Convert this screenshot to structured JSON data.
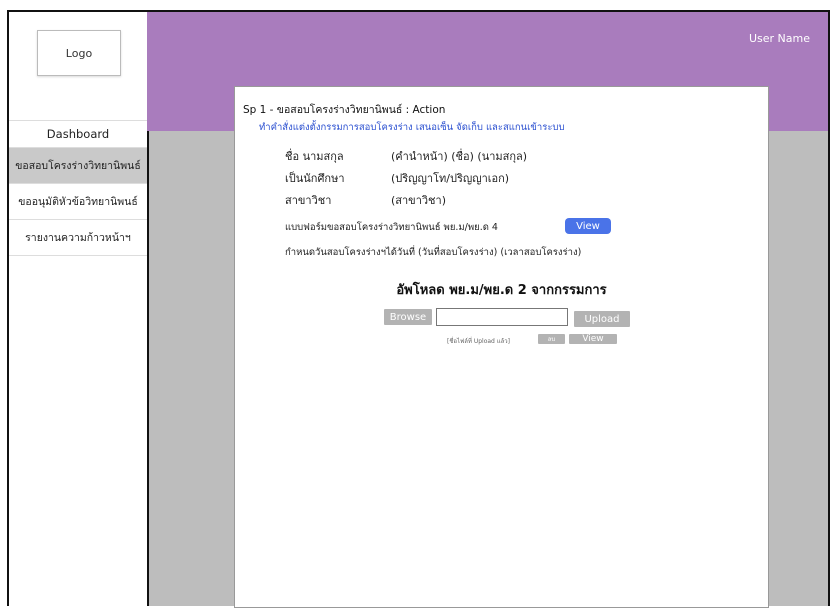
{
  "sidebar": {
    "logo": "Logo",
    "items": [
      {
        "label": "Dashboard"
      },
      {
        "label": "ขอสอบโครงร่างวิทยานิพนธ์"
      },
      {
        "label": "ขออนุมัติหัวข้อวิทยานิพนธ์"
      },
      {
        "label": "รายงานความก้าวหน้าฯ"
      }
    ]
  },
  "header": {
    "user_name": "User Name"
  },
  "panel": {
    "title": "Sp 1 - ขอสอบโครงร่างวิทยานิพนธ์ : Action",
    "subtitle": "ทำคำสั่งแต่งตั้งกรรมการสอบโครงร่าง เสนอเซ็น จัดเก็บ และสแกนเข้าระบบ",
    "fields": [
      {
        "label": "ชื่อ นามสกุล",
        "value": "(คำนำหน้า) (ชื่อ) (นามสกุล)"
      },
      {
        "label": "เป็นนักศึกษา",
        "value": "(ปริญญาโท/ปริญญาเอก)"
      },
      {
        "label": "สาขาวิชา",
        "value": "(สาขาวิชา)"
      }
    ],
    "form_text": "แบบฟอร์มขอสอบโครงร่างวิทยานิพนธ์ พย.ม/พย.ด 4",
    "view_label": "View",
    "date_text": "กำหนดวันสอบโครงร่างฯได้วันที่ (วันที่สอบโครงร่าง) (เวลาสอบโครงร่าง)",
    "upload_title": "อัพโหลด พย.ม/พย.ด 2 จากกรรมการ",
    "browse_label": "Browse",
    "upload_label": "Upload",
    "file_note": "[ชื่อไฟล์ที่ Upload แล้ว]",
    "delete_label": "ลบ",
    "view2_label": "View"
  }
}
